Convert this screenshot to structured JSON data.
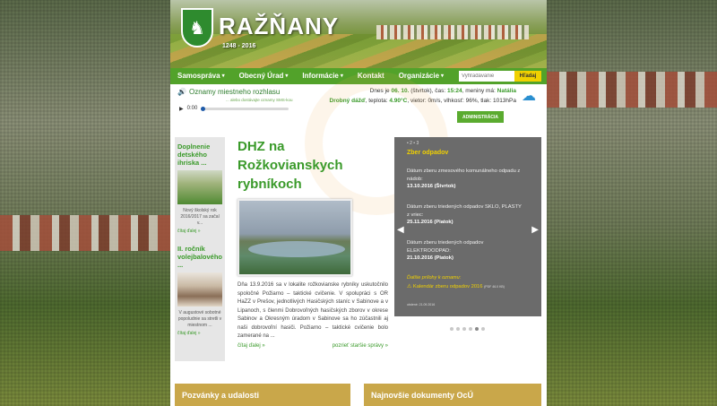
{
  "header": {
    "title": "RAŽŇANY",
    "years": "1248 - 2016",
    "crest_icon": "goat-crest"
  },
  "nav": {
    "items": [
      {
        "label": "Samospráva",
        "caret": "▾"
      },
      {
        "label": "Obecný Úrad",
        "caret": "▾"
      },
      {
        "label": "Informácie",
        "caret": "▾"
      },
      {
        "label": "Kontakt",
        "caret": ""
      },
      {
        "label": "Organizácie",
        "caret": "▾"
      }
    ],
    "search_placeholder": "Vyhľadávanie",
    "search_button": "Hľadaj"
  },
  "rozhlas": {
    "title": "Oznamy miestneho rozhlasu",
    "note": "... alebo dostávajte oznamy SMS-kou",
    "player_time": "0:00"
  },
  "weather": {
    "line1_prefix": "Dnes je",
    "date": "06. 10.",
    "day": "(štvrtok), čas:",
    "time": "15:24",
    "nameday_label": ", meniny má:",
    "nameday": "Natália",
    "line2_cond": "Drobný dážď",
    "line2_temp_label": ", teplota:",
    "temp": "4.90°C",
    "line2_rest": ", vietor: 0m/s, vlhkosť: 96%, tlak: 1013hPa",
    "admin_label": "ADMINISTRÁCIA"
  },
  "sidebar": {
    "items": [
      {
        "title": "Doplnenie detského ihriska ...",
        "text": "Nový školský rok 2016/2017 sa začal v...",
        "more": "čítaj ďalej »"
      },
      {
        "title": "II. ročník volejbalového ...",
        "text": "V augustové sobotné popoludnie sa stretli v miestnom ...",
        "more": "čítaj ďalej »"
      }
    ]
  },
  "article": {
    "title": "DHZ na Rožkovianskych rybníkoch",
    "body": "Dňa 13.9.2016 sa v lokalite rožkovianske rybníky uskutočnilo spoločné Požiarno – taktické cvičenie. V spolupráci s OR HaZZ v Prešov, jednotlivých Hasičských staníc v Sabinove a v Lipanoch, s členmi Dobrovoľných hasičských zborov v okrese Sabinov a Okresným úradom v Sabinove sa ho zúčastnili aj naši dobrovoľní hasiči. Požiarno – taktické cvičenie bolo zamerané na ...",
    "more": "čítaj ďalej »",
    "older": "pozrieť staršie správy »"
  },
  "slider": {
    "dots": "• 2 • 3",
    "title": "Zber odpadov",
    "blocks": [
      {
        "text": "Dátum zberu zmesového komunálneho odpadu z nádob:",
        "date": "13.10.2016 (Štvrtok)"
      },
      {
        "text": "Dátum zberu triedených odpadov SKLO, PLASTY z vriec:",
        "date": "25.11.2016 (Piatok)"
      },
      {
        "text": "Dátum zberu triedených odpadov ELEKTROODPAD:",
        "date": "21.10.2016 (Piatok)"
      }
    ],
    "extra": "Ďalšie prílohy k oznamu:",
    "calendar": "Kalendár zberu odpadov 2016",
    "calendar_meta": "(PDF 46.0 KB)",
    "updated": "obdené: 21.09.2016"
  },
  "bottom": {
    "left": "Pozvánky a udalosti",
    "right": "Najnovšie dokumenty OcÚ"
  }
}
